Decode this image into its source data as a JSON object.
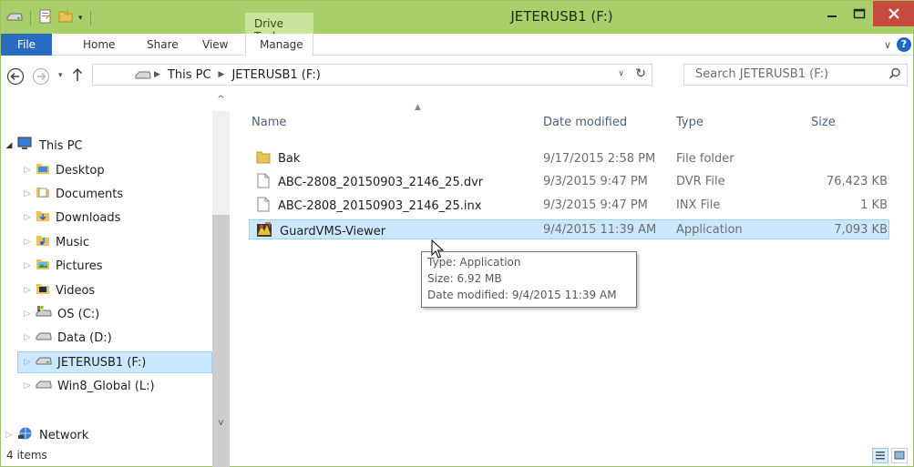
{
  "window": {
    "title": "JETERUSB1 (F:)",
    "context_tab": "Drive Tools",
    "controls": {
      "minimize": "–",
      "maximize": "□",
      "close": "✕"
    }
  },
  "ribbon": {
    "tabs": [
      {
        "label": "File"
      },
      {
        "label": "Home"
      },
      {
        "label": "Share"
      },
      {
        "label": "View"
      },
      {
        "label": "Manage"
      }
    ],
    "help": "?"
  },
  "address": {
    "breadcrumbs": [
      "This PC",
      "JETERUSB1 (F:)"
    ],
    "search_placeholder": "Search JETERUSB1 (F:)"
  },
  "nav_pane": {
    "items": [
      {
        "label": "This PC",
        "icon": "computer-icon"
      },
      {
        "label": "Desktop",
        "icon": "desktop-folder-icon"
      },
      {
        "label": "Documents",
        "icon": "documents-folder-icon"
      },
      {
        "label": "Downloads",
        "icon": "downloads-folder-icon"
      },
      {
        "label": "Music",
        "icon": "music-folder-icon"
      },
      {
        "label": "Pictures",
        "icon": "pictures-folder-icon"
      },
      {
        "label": "Videos",
        "icon": "videos-folder-icon"
      },
      {
        "label": "OS (C:)",
        "icon": "windows-drive-icon"
      },
      {
        "label": "Data (D:)",
        "icon": "drive-icon"
      },
      {
        "label": "JETERUSB1 (F:)",
        "icon": "usb-drive-icon",
        "selected": true
      },
      {
        "label": "Win8_Global (L:)",
        "icon": "drive-icon"
      },
      {
        "label": "Network",
        "icon": "network-icon"
      }
    ]
  },
  "file_list": {
    "columns": [
      "Name",
      "Date modified",
      "Type",
      "Size"
    ],
    "rows": [
      {
        "name": "Bak",
        "date": "9/17/2015 2:58 PM",
        "type": "File folder",
        "size": "",
        "icon": "folder-icon"
      },
      {
        "name": "ABC-2808_20150903_2146_25.dvr",
        "date": "9/3/2015 9:47 PM",
        "type": "DVR File",
        "size": "76,423 KB",
        "icon": "file-icon"
      },
      {
        "name": "ABC-2808_20150903_2146_25.inx",
        "date": "9/3/2015 9:47 PM",
        "type": "INX File",
        "size": "1 KB",
        "icon": "file-icon"
      },
      {
        "name": "GuardVMS-Viewer",
        "date": "9/4/2015 11:39 AM",
        "type": "Application",
        "size": "7,093 KB",
        "icon": "application-icon",
        "selected": true
      }
    ]
  },
  "tooltip": {
    "lines": [
      "Type: Application",
      "Size: 6.92 MB",
      "Date modified: 9/4/2015 11:39 AM"
    ]
  },
  "status": {
    "item_count": "4 items"
  },
  "colors": {
    "titlebar": "#a9cf6b",
    "file_tab": "#2a6bc4",
    "close_button": "#c64a3e",
    "selection": "#cce8ff",
    "column_header": "#4c607a"
  }
}
